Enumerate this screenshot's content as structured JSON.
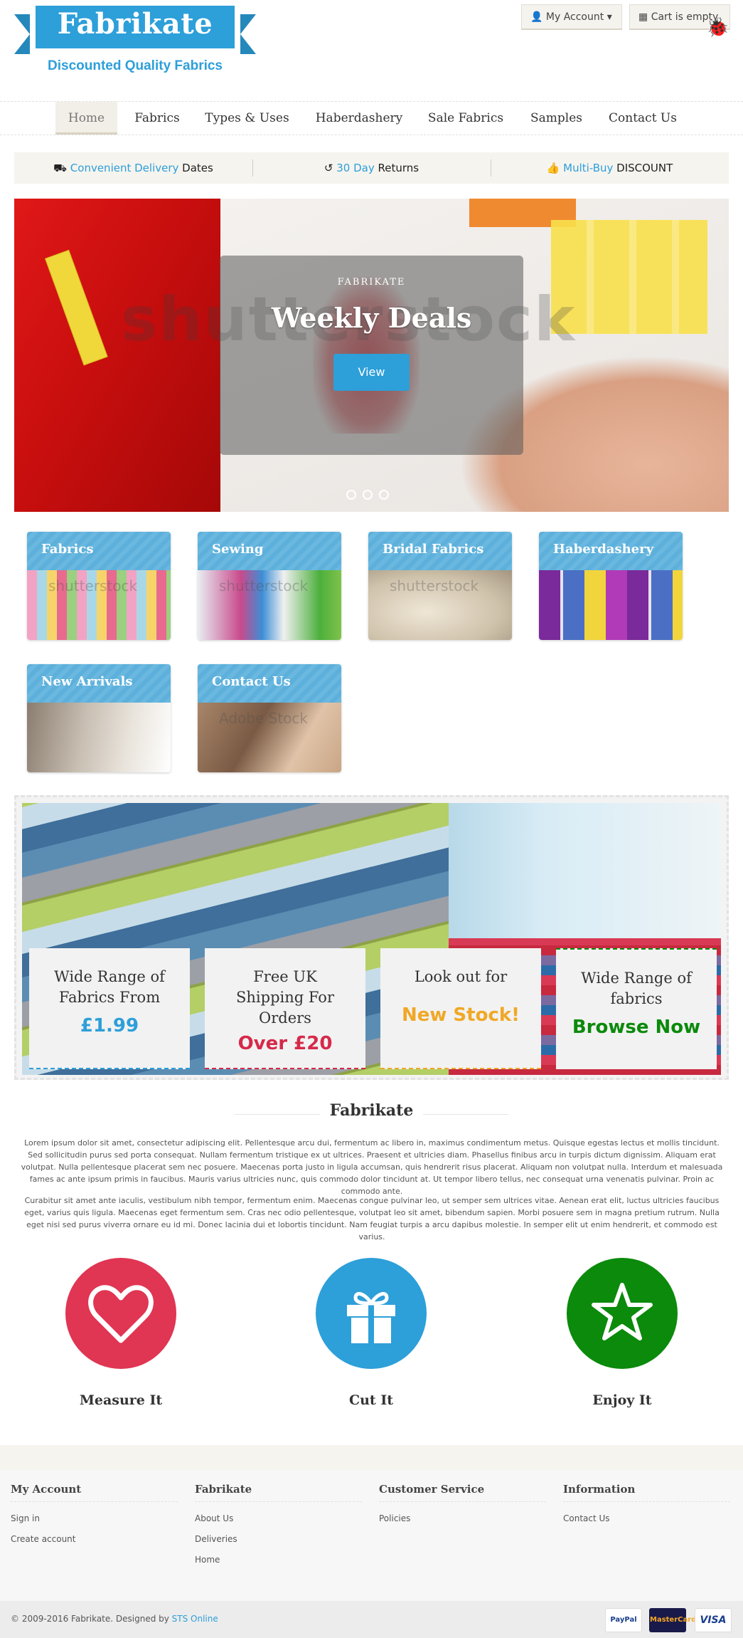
{
  "header": {
    "logo_title": "Fabrikate",
    "logo_subtitle": "Discounted Quality Fabrics",
    "account_label": "My Account",
    "cart_label": "Cart is empty"
  },
  "nav": {
    "items": [
      "Home",
      "Fabrics",
      "Types & Uses",
      "Haberdashery",
      "Sale Fabrics",
      "Samples",
      "Contact Us"
    ],
    "active": "Home"
  },
  "usp": [
    {
      "highlight": "Convenient Delivery",
      "rest": "Dates",
      "icon": "truck-icon"
    },
    {
      "highlight": "30 Day",
      "rest": "Returns",
      "icon": "undo-icon"
    },
    {
      "highlight": "Multi-Buy",
      "rest": "DISCOUNT",
      "icon": "thumbs-up-icon"
    }
  ],
  "hero": {
    "kicker": "FABRIKATE",
    "title": "Weekly Deals",
    "button": "View",
    "watermark": "shutterstock",
    "slide_count": 3
  },
  "tiles": [
    {
      "label": "Fabrics",
      "watermark": "shutterstock"
    },
    {
      "label": "Sewing",
      "watermark": "shutterstock"
    },
    {
      "label": "Bridal Fabrics",
      "watermark": "shutterstock"
    },
    {
      "label": "Haberdashery",
      "watermark": ""
    },
    {
      "label": "New Arrivals",
      "watermark": ""
    },
    {
      "label": "Contact Us",
      "watermark": "Adobe Stock"
    }
  ],
  "promos": [
    {
      "line1": "Wide Range of",
      "line2": "Fabrics From",
      "line3": "",
      "big": "£1.99",
      "color": "#2d9fd9"
    },
    {
      "line1": "Free UK",
      "line2": "Shipping For",
      "line3": "Orders",
      "big": "Over £20",
      "color": "#d6294a"
    },
    {
      "line1": "Look out for",
      "line2": "",
      "line3": "",
      "big": "New Stock!",
      "color": "#f0a826"
    },
    {
      "line1": "Wide Range of",
      "line2": "fabrics",
      "line3": "",
      "big": "Browse Now",
      "color": "#0b8a0b"
    }
  ],
  "about": {
    "title": "Fabrikate",
    "p1": "Lorem ipsum dolor sit amet, consectetur adipiscing elit. Pellentesque arcu dui, fermentum ac libero in, maximus condimentum metus. Quisque egestas lectus et mollis tincidunt. Sed sollicitudin purus sed porta consequat. Nullam fermentum tristique ex ut ultrices. Praesent et ultricies diam. Phasellus finibus arcu in turpis dictum dignissim. Aliquam erat volutpat. Nulla pellentesque placerat sem nec posuere. Maecenas porta justo in ligula accumsan, quis hendrerit risus placerat. Aliquam non volutpat nulla. Interdum et malesuada fames ac ante ipsum primis in faucibus. Mauris varius ultricies nunc, quis commodo dolor tincidunt at. Ut tempor libero tellus, nec consequat urna venenatis pulvinar. Proin ac commodo ante.",
    "p2": "Curabitur sit amet ante iaculis, vestibulum nibh tempor, fermentum enim. Maecenas congue pulvinar leo, ut semper sem ultrices vitae. Aenean erat elit, luctus ultricies faucibus eget, varius quis ligula. Maecenas eget fermentum sem. Cras nec odio pellentesque, volutpat leo sit amet, bibendum sapien. Morbi posuere sem in magna pretium rutrum. Nulla eget nisi sed purus viverra ornare eu id mi. Donec lacinia dui et lobortis tincidunt. Nam feugiat turpis a arcu dapibus molestie. In semper elit ut enim hendrerit, et commodo est varius."
  },
  "steps": [
    {
      "label": "Measure It",
      "icon": "heart-icon",
      "color": "#e03553"
    },
    {
      "label": "Cut It",
      "icon": "gift-icon",
      "color": "#2d9fd9"
    },
    {
      "label": "Enjoy It",
      "icon": "star-icon",
      "color": "#0b8a0b"
    }
  ],
  "footer": {
    "columns": [
      {
        "title": "My Account",
        "links": [
          "Sign in",
          "Create account"
        ]
      },
      {
        "title": "Fabrikate",
        "links": [
          "About Us",
          "Deliveries",
          "Home"
        ]
      },
      {
        "title": "Customer Service",
        "links": [
          "Policies"
        ]
      },
      {
        "title": "Information",
        "links": [
          "Contact Us"
        ]
      }
    ],
    "copyright_prefix": "© 2009-2016 Fabrikate.  Designed by ",
    "designer": "STS Online",
    "payments": [
      "PayPal",
      "MasterCard",
      "VISA"
    ]
  }
}
